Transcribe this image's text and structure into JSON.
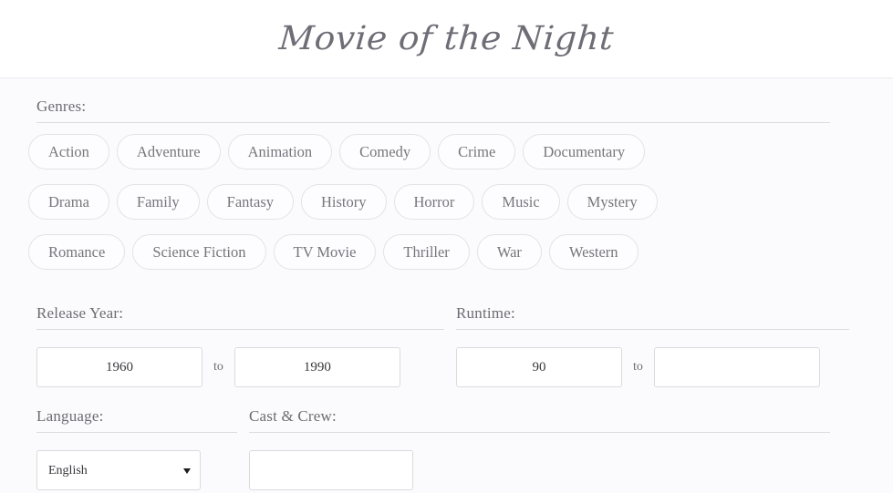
{
  "header": {
    "title": "Movie of the Night"
  },
  "genres": {
    "legend": "Genres:",
    "rows": [
      [
        "Action",
        "Adventure",
        "Animation",
        "Comedy",
        "Crime",
        "Documentary"
      ],
      [
        "Drama",
        "Family",
        "Fantasy",
        "History",
        "Horror",
        "Music",
        "Mystery"
      ],
      [
        "Romance",
        "Science Fiction",
        "TV Movie",
        "Thriller",
        "War",
        "Western"
      ]
    ]
  },
  "release_year": {
    "legend": "Release Year:",
    "from_value": "1960",
    "from_placeholder": "",
    "separator": "to",
    "to_value": "1990",
    "to_placeholder": ""
  },
  "runtime": {
    "legend": "Runtime:",
    "from_value": "90",
    "from_placeholder": "",
    "separator": "to",
    "to_value": "",
    "to_placeholder": ""
  },
  "language": {
    "legend": "Language:",
    "selected": "English",
    "caret_icon": "chevron-down-icon"
  },
  "cast_crew": {
    "legend": "Cast & Crew:",
    "value": "",
    "placeholder": ""
  },
  "colors": {
    "page_background": "#fbfafc",
    "header_background": "#ffffff",
    "title_text": "#6f6e77",
    "label_text": "#6c6c74",
    "chip_border": "#e4e2e6",
    "chip_text": "#77767d",
    "input_border": "#dcdade",
    "rule": "#dedce0"
  }
}
